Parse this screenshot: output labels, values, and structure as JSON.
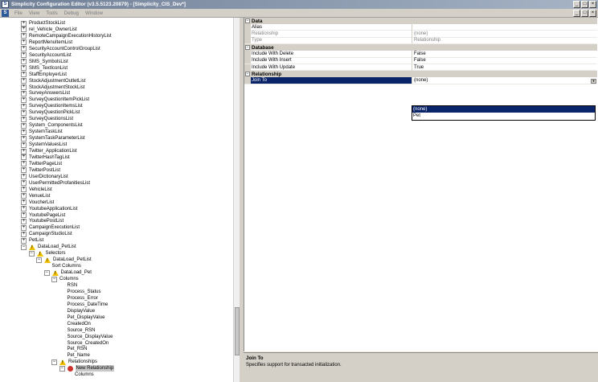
{
  "window": {
    "title": "Simplicity Configuration Editor (v3.5.5123.20879) - [Simplicity_CIS_Dev*]",
    "buttons": [
      "_",
      "□",
      "×"
    ],
    "mdi_buttons": [
      "_",
      "□",
      "×"
    ]
  },
  "menu": [
    "File",
    "View",
    "Tools",
    "Debug",
    "Window"
  ],
  "tree": {
    "items": [
      {
        "label": "ProductStockList",
        "level": 0,
        "expander": "+",
        "icon": null
      },
      {
        "label": "rel_Vehicle_OwnerList",
        "level": 0,
        "expander": "+",
        "icon": null
      },
      {
        "label": "RemoteCampaignExecutionHistoryList",
        "level": 0,
        "expander": "+",
        "icon": null
      },
      {
        "label": "ReportMenuItemList",
        "level": 0,
        "expander": "+",
        "icon": null
      },
      {
        "label": "SecurityAccountControlGroupList",
        "level": 0,
        "expander": "+",
        "icon": null
      },
      {
        "label": "SecurityAccountList",
        "level": 0,
        "expander": "+",
        "icon": null
      },
      {
        "label": "SMS_SymbolsList",
        "level": 0,
        "expander": "+",
        "icon": null
      },
      {
        "label": "SMS_TextIconList",
        "level": 0,
        "expander": "+",
        "icon": null
      },
      {
        "label": "StaffEmployerList",
        "level": 0,
        "expander": "+",
        "icon": null
      },
      {
        "label": "StockAdjustmentOutletList",
        "level": 0,
        "expander": "+",
        "icon": null
      },
      {
        "label": "StockAdjustmentStockList",
        "level": 0,
        "expander": "+",
        "icon": null
      },
      {
        "label": "SurveyAnswersList",
        "level": 0,
        "expander": "+",
        "icon": null
      },
      {
        "label": "SurveyQuestionItemPickList",
        "level": 0,
        "expander": "+",
        "icon": null
      },
      {
        "label": "SurveyQuestionItemsList",
        "level": 0,
        "expander": "+",
        "icon": null
      },
      {
        "label": "SurveyQuestionPickList",
        "level": 0,
        "expander": "+",
        "icon": null
      },
      {
        "label": "SurveyQuestionsList",
        "level": 0,
        "expander": "+",
        "icon": null
      },
      {
        "label": "System_ComponentsList",
        "level": 0,
        "expander": "+",
        "icon": null
      },
      {
        "label": "SystemTaskList",
        "level": 0,
        "expander": "+",
        "icon": null
      },
      {
        "label": "SystemTaskParameterList",
        "level": 0,
        "expander": "+",
        "icon": null
      },
      {
        "label": "SystemValuesList",
        "level": 0,
        "expander": "+",
        "icon": null
      },
      {
        "label": "Twitter_ApplicationList",
        "level": 0,
        "expander": "+",
        "icon": null
      },
      {
        "label": "TwitterHashTagList",
        "level": 0,
        "expander": "+",
        "icon": null
      },
      {
        "label": "TwitterPageList",
        "level": 0,
        "expander": "+",
        "icon": null
      },
      {
        "label": "TwitterPostList",
        "level": 0,
        "expander": "+",
        "icon": null
      },
      {
        "label": "UserDictionaryList",
        "level": 0,
        "expander": "+",
        "icon": null
      },
      {
        "label": "UserPermittedProfanitiesList",
        "level": 0,
        "expander": "+",
        "icon": null
      },
      {
        "label": "VehicleList",
        "level": 0,
        "expander": "+",
        "icon": null
      },
      {
        "label": "VenueList",
        "level": 0,
        "expander": "+",
        "icon": null
      },
      {
        "label": "VoucherList",
        "level": 0,
        "expander": "+",
        "icon": null
      },
      {
        "label": "YoutubeApplicationList",
        "level": 0,
        "expander": "+",
        "icon": null
      },
      {
        "label": "YoutubePageList",
        "level": 0,
        "expander": "+",
        "icon": null
      },
      {
        "label": "YoutubePostList",
        "level": 0,
        "expander": "+",
        "icon": null
      },
      {
        "label": "CampaignExecutionList",
        "level": 0,
        "expander": "+",
        "icon": null
      },
      {
        "label": "CampaignStudioList",
        "level": 0,
        "expander": "+",
        "icon": null
      },
      {
        "label": "PetList",
        "level": 0,
        "expander": "+",
        "icon": null
      },
      {
        "label": "DataLoad_PetList",
        "level": 0,
        "expander": "−",
        "icon": "warning"
      },
      {
        "label": "Selectors",
        "level": 1,
        "expander": "−",
        "icon": "warning"
      },
      {
        "label": "DataLoad_PetList",
        "level": 2,
        "expander": "−",
        "icon": "warning"
      },
      {
        "label": "Sort Columns",
        "level": 3,
        "expander": "",
        "icon": null
      },
      {
        "label": "DataLoad_Pet",
        "level": 3,
        "expander": "−",
        "icon": "warning"
      },
      {
        "label": "Columns",
        "level": 4,
        "expander": "−",
        "icon": null
      },
      {
        "label": "RSN",
        "level": 5,
        "expander": "",
        "icon": null
      },
      {
        "label": "Process_Status",
        "level": 5,
        "expander": "",
        "icon": null
      },
      {
        "label": "Process_Error",
        "level": 5,
        "expander": "",
        "icon": null
      },
      {
        "label": "Process_DateTime",
        "level": 5,
        "expander": "",
        "icon": null
      },
      {
        "label": "DisplayValue",
        "level": 5,
        "expander": "",
        "icon": null
      },
      {
        "label": "Pet_DisplayValue",
        "level": 5,
        "expander": "",
        "icon": null
      },
      {
        "label": "CreatedOn",
        "level": 5,
        "expander": "",
        "icon": null
      },
      {
        "label": "Source_RSN",
        "level": 5,
        "expander": "",
        "icon": null
      },
      {
        "label": "Source_DisplayValue",
        "level": 5,
        "expander": "",
        "icon": null
      },
      {
        "label": "Source_CreatedOn",
        "level": 5,
        "expander": "",
        "icon": null
      },
      {
        "label": "Pet_RSN",
        "level": 5,
        "expander": "",
        "icon": null
      },
      {
        "label": "Pet_Name",
        "level": 5,
        "expander": "",
        "icon": null
      },
      {
        "label": "Relationships",
        "level": 4,
        "expander": "−",
        "icon": "warning"
      },
      {
        "label": "New Relationship",
        "level": 5,
        "expander": "−",
        "icon": "error",
        "selected": true
      },
      {
        "label": "Columns",
        "level": 6,
        "expander": "",
        "icon": null
      }
    ]
  },
  "properties": {
    "categories": [
      {
        "label": "Data",
        "rows": [
          {
            "name": "Alias",
            "value": "",
            "readonly": false
          },
          {
            "name": "Relationship",
            "value": "(none)",
            "readonly": true
          },
          {
            "name": "Type",
            "value": "Relationship",
            "readonly": true
          }
        ]
      },
      {
        "label": "Database",
        "rows": [
          {
            "name": "Include With Delete",
            "value": "False",
            "readonly": false
          },
          {
            "name": "Include With Insert",
            "value": "False",
            "readonly": false
          },
          {
            "name": "Include With Update",
            "value": "True",
            "readonly": false
          }
        ]
      },
      {
        "label": "Relationship",
        "rows": [
          {
            "name": "Join To",
            "value": "(none)",
            "readonly": false,
            "selected": true,
            "dropdown": true
          }
        ]
      }
    ],
    "dropdown_options": [
      {
        "label": "(none)",
        "selected": true
      },
      {
        "label": "Pet",
        "selected": false
      }
    ]
  },
  "description": {
    "title": "Join To",
    "text": "Specifies support for transacted initialization."
  }
}
